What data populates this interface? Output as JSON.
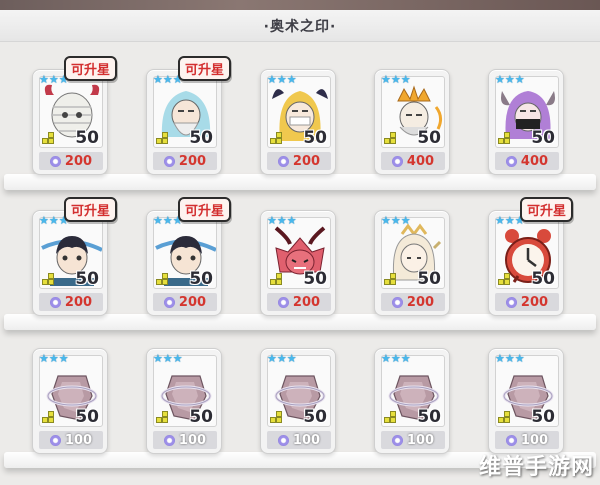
{
  "header": {
    "title": "·奥术之印·"
  },
  "badge_text": "可升星",
  "watermark": "维普手游网",
  "colors": {
    "star": "#49b8ec",
    "cost_red": "#d4362f",
    "badge_red": "#d32f2f",
    "gem": "#8a7cdf"
  },
  "rows": [
    {
      "cards": [
        {
          "level": "50",
          "cost": "200",
          "stars": 3,
          "upgradable": true,
          "portrait": "mummy-icon"
        },
        {
          "level": "50",
          "cost": "200",
          "stars": 3,
          "upgradable": true,
          "portrait": "ice-sage-icon"
        },
        {
          "level": "50",
          "cost": "200",
          "stars": 3,
          "upgradable": false,
          "portrait": "blonde-masked-icon"
        },
        {
          "level": "50",
          "cost": "400",
          "stars": 3,
          "upgradable": false,
          "portrait": "golden-crown-icon"
        },
        {
          "level": "50",
          "cost": "400",
          "stars": 3,
          "upgradable": false,
          "portrait": "purple-horned-icon"
        }
      ]
    },
    {
      "cards": [
        {
          "level": "50",
          "cost": "200",
          "stars": 3,
          "upgradable": true,
          "portrait": "dark-hair-boy-icon"
        },
        {
          "level": "50",
          "cost": "200",
          "stars": 3,
          "upgradable": true,
          "portrait": "dark-hair-boy-icon"
        },
        {
          "level": "50",
          "cost": "200",
          "stars": 3,
          "upgradable": false,
          "portrait": "red-demon-icon"
        },
        {
          "level": "50",
          "cost": "200",
          "stars": 3,
          "upgradable": false,
          "portrait": "white-hair-girl-icon"
        },
        {
          "level": "50",
          "cost": "200",
          "stars": 3,
          "upgradable": true,
          "portrait": "clock-icon"
        }
      ]
    },
    {
      "cards": [
        {
          "level": "50",
          "cost": "100",
          "stars": 3,
          "upgradable": false,
          "portrait": "rune-stone-icon"
        },
        {
          "level": "50",
          "cost": "100",
          "stars": 3,
          "upgradable": false,
          "portrait": "rune-stone-icon"
        },
        {
          "level": "50",
          "cost": "100",
          "stars": 3,
          "upgradable": false,
          "portrait": "rune-stone-icon"
        },
        {
          "level": "50",
          "cost": "100",
          "stars": 3,
          "upgradable": false,
          "portrait": "rune-stone-icon"
        },
        {
          "level": "50",
          "cost": "100",
          "stars": 3,
          "upgradable": false,
          "portrait": "rune-stone-icon"
        }
      ]
    }
  ]
}
